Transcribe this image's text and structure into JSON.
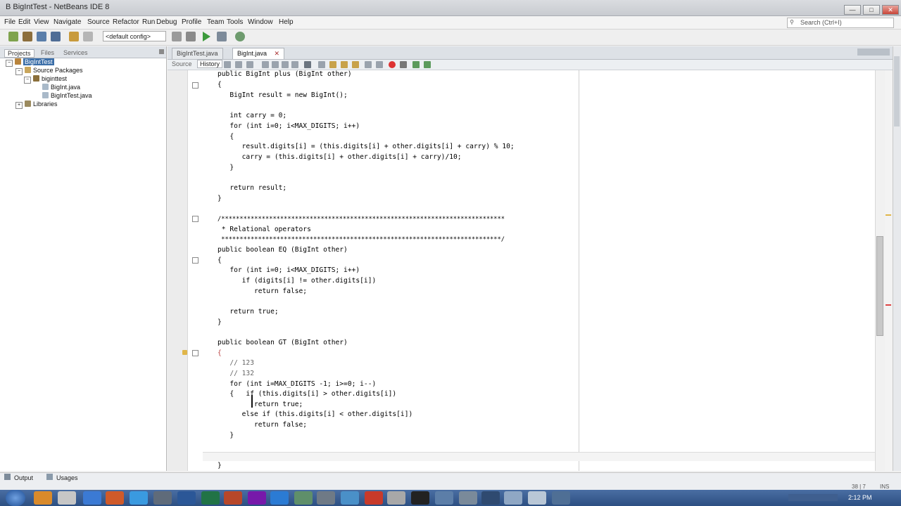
{
  "window": {
    "title": "B BigIntTest - NetBeans IDE 8",
    "controls": [
      "—",
      "□",
      "✕"
    ]
  },
  "menubar": {
    "items": [
      "File",
      "Edit",
      "View",
      "Navigate",
      "Source",
      "Refactor",
      "Run",
      "Debug",
      "Profile",
      "Team",
      "Tools",
      "Window",
      "Help"
    ]
  },
  "search": {
    "placeholder": "Search (Ctrl+I)"
  },
  "toolbar": {
    "config": "<default config>"
  },
  "left_panel": {
    "tabs": [
      "Projects",
      "Files",
      "Services"
    ],
    "tree": [
      {
        "label": "BigIntTest",
        "indent": 0
      },
      {
        "label": "Source Packages",
        "indent": 1
      },
      {
        "label": "biginttest",
        "indent": 2
      },
      {
        "label": "BigInt.java",
        "indent": 3
      },
      {
        "label": "BigIntTest.java",
        "indent": 3
      },
      {
        "label": "Libraries",
        "indent": 1
      }
    ]
  },
  "editor": {
    "tabs": [
      {
        "label": "BigIntTest.java",
        "active": false
      },
      {
        "label": "BigInt.java",
        "active": true
      }
    ],
    "tab_close": "✕",
    "source_tab": "Source",
    "history_tab": "History"
  },
  "code_lines": [
    "public BigInt plus (BigInt other)",
    "{",
    "   BigInt result = new BigInt();",
    "",
    "   int carry = 0;",
    "   for (int i=0; i<MAX_DIGITS; i++)",
    "   {",
    "      result.digits[i] = (this.digits[i] + other.digits[i] + carry) % 10;",
    "      carry = (this.digits[i] + other.digits[i] + carry)/10;",
    "   }",
    "",
    "   return result;",
    "}",
    "",
    "/*****************************************************************************",
    " * Relational operators",
    " ****************************************************************************/",
    "public boolean EQ (BigInt other)",
    "{",
    "   for (int i=0; i<MAX_DIGITS; i++)",
    "      if (digits[i] != other.digits[i])",
    "         return false;",
    "",
    "   return true;",
    "}",
    "",
    "public boolean GT (BigInt other)",
    "{",
    "   // 123",
    "   // 132",
    "   for (int i=MAX_DIGITS -1; i>=0; i--)",
    "   {   if (this.digits[i] > other.digits[i])",
    "         return true;",
    "      else if (this.digits[i] < other.digits[i])",
    "         return false;",
    "   }",
    "",
    "",
    "}"
  ],
  "bottom": {
    "output": "Output",
    "usages": "Usages",
    "position": "38 | 7",
    "mode": "INS"
  },
  "taskbar": {
    "clock": "2:12 PM"
  },
  "colors": {
    "field": "#2d7a2d",
    "taskbar": "#2c4f82"
  }
}
